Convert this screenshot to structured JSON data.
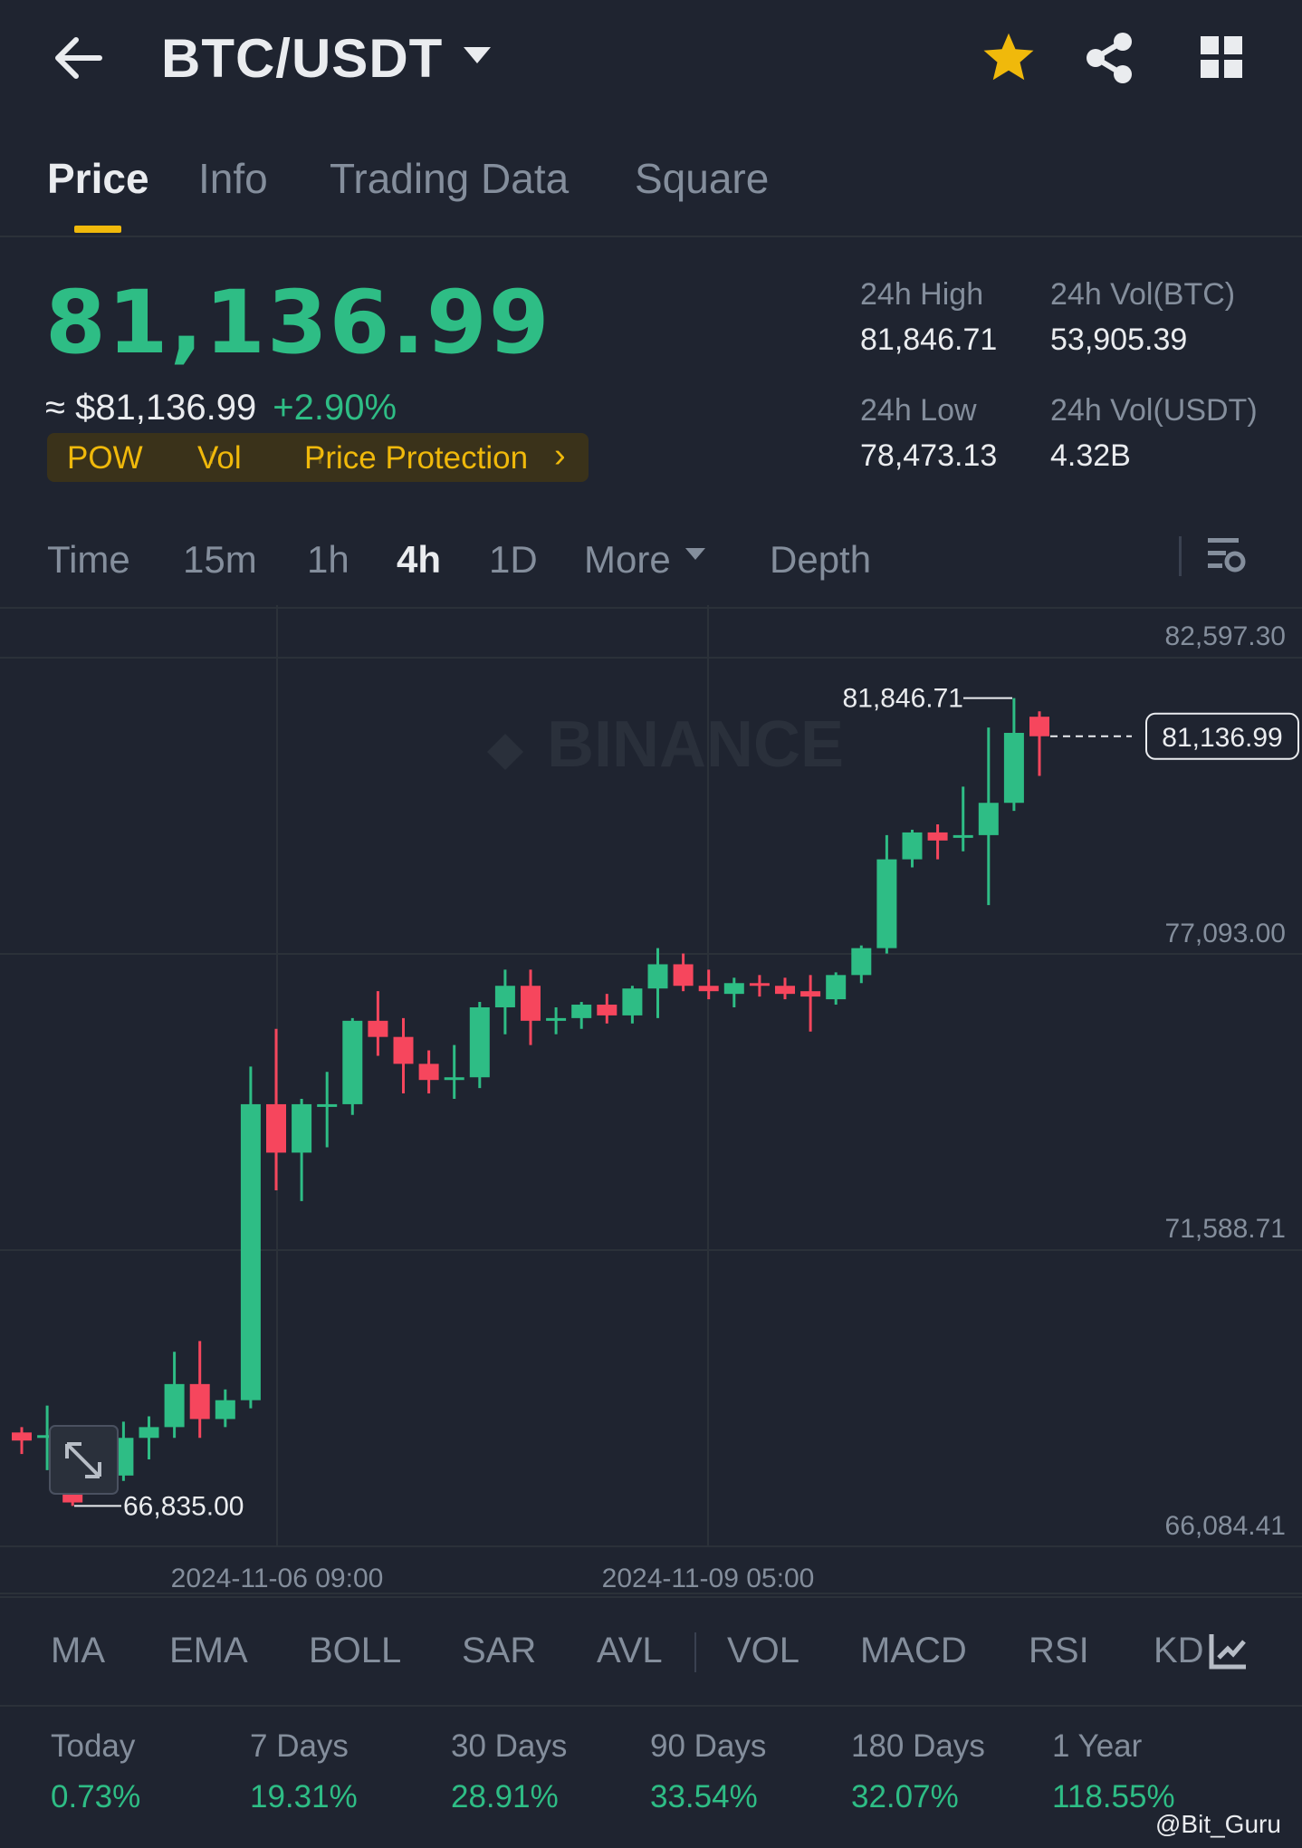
{
  "header": {
    "pair": "BTC/USDT",
    "icons": [
      "back-arrow-icon",
      "dropdown-caret-icon",
      "star-icon",
      "share-icon",
      "grid-menu-icon"
    ],
    "star_color": "#f0b90b"
  },
  "tabs": [
    "Price",
    "Info",
    "Trading Data",
    "Square"
  ],
  "active_tab": "Price",
  "price": {
    "last": "81,136.99",
    "fiat": "≈ $81,136.99",
    "change": "+2.90%",
    "color_up": "#2ebd85",
    "color_down": "#f6465d"
  },
  "tags": {
    "pow": "POW",
    "vol": "Vol",
    "protection": "Price Protection",
    "arrow": "›"
  },
  "stats": {
    "high_label": "24h High",
    "high_value": "81,846.71",
    "low_label": "24h Low",
    "low_value": "78,473.13",
    "vol_btc_label": "24h Vol(BTC)",
    "vol_btc_value": "53,905.39",
    "vol_usdt_label": "24h Vol(USDT)",
    "vol_usdt_value": "4.32B"
  },
  "intervals": {
    "time": "Time",
    "m15": "15m",
    "h1": "1h",
    "h4": "4h",
    "d1": "1D",
    "more": "More",
    "depth": "Depth",
    "active": "4h"
  },
  "chart_data": {
    "type": "candlestick",
    "interval": "4h",
    "y_ticks": [
      "82,597.30",
      "77,093.00",
      "71,588.71",
      "66,084.41"
    ],
    "ylim": [
      66084.41,
      82597.3
    ],
    "x_ticks": [
      "2024-11-06 09:00",
      "2024-11-09 05:00"
    ],
    "high_marker": "81,846.71",
    "low_marker": "66,835.00",
    "last_price": "81,136.99",
    "watermark": "BINANCE",
    "candles": [
      {
        "o": 68200,
        "h": 68300,
        "l": 67800,
        "c": 68050
      },
      {
        "o": 68150,
        "h": 68700,
        "l": 67500,
        "c": 68150
      },
      {
        "o": 68050,
        "h": 68300,
        "l": 66835,
        "c": 66900
      },
      {
        "o": 67300,
        "h": 68000,
        "l": 67200,
        "c": 67400
      },
      {
        "o": 67400,
        "h": 68400,
        "l": 67300,
        "c": 68100
      },
      {
        "o": 68100,
        "h": 68500,
        "l": 67700,
        "c": 68300
      },
      {
        "o": 68300,
        "h": 69700,
        "l": 68100,
        "c": 69100
      },
      {
        "o": 69100,
        "h": 69900,
        "l": 68100,
        "c": 68450
      },
      {
        "o": 68450,
        "h": 69000,
        "l": 68300,
        "c": 68800
      },
      {
        "o": 68800,
        "h": 75000,
        "l": 68650,
        "c": 74300
      },
      {
        "o": 74300,
        "h": 75700,
        "l": 72700,
        "c": 73400
      },
      {
        "o": 73400,
        "h": 74400,
        "l": 72500,
        "c": 74300
      },
      {
        "o": 74300,
        "h": 74900,
        "l": 73500,
        "c": 74300
      },
      {
        "o": 74300,
        "h": 75900,
        "l": 74100,
        "c": 75850
      },
      {
        "o": 75850,
        "h": 76400,
        "l": 75200,
        "c": 75550
      },
      {
        "o": 75550,
        "h": 75900,
        "l": 74500,
        "c": 75050
      },
      {
        "o": 75050,
        "h": 75300,
        "l": 74500,
        "c": 74750
      },
      {
        "o": 74800,
        "h": 75400,
        "l": 74400,
        "c": 74800
      },
      {
        "o": 74800,
        "h": 76200,
        "l": 74600,
        "c": 76100
      },
      {
        "o": 76100,
        "h": 76800,
        "l": 75600,
        "c": 76500
      },
      {
        "o": 76500,
        "h": 76800,
        "l": 75400,
        "c": 75850
      },
      {
        "o": 75850,
        "h": 76100,
        "l": 75600,
        "c": 75900
      },
      {
        "o": 75900,
        "h": 76200,
        "l": 75700,
        "c": 76150
      },
      {
        "o": 76150,
        "h": 76350,
        "l": 75800,
        "c": 75950
      },
      {
        "o": 75950,
        "h": 76500,
        "l": 75800,
        "c": 76450
      },
      {
        "o": 76450,
        "h": 77200,
        "l": 75900,
        "c": 76900
      },
      {
        "o": 76900,
        "h": 77100,
        "l": 76400,
        "c": 76500
      },
      {
        "o": 76500,
        "h": 76800,
        "l": 76250,
        "c": 76400
      },
      {
        "o": 76350,
        "h": 76650,
        "l": 76100,
        "c": 76550
      },
      {
        "o": 76550,
        "h": 76700,
        "l": 76300,
        "c": 76500
      },
      {
        "o": 76500,
        "h": 76650,
        "l": 76250,
        "c": 76350
      },
      {
        "o": 76400,
        "h": 76700,
        "l": 75650,
        "c": 76300
      },
      {
        "o": 76250,
        "h": 76750,
        "l": 76150,
        "c": 76700
      },
      {
        "o": 76700,
        "h": 77250,
        "l": 76550,
        "c": 77200
      },
      {
        "o": 77200,
        "h": 79300,
        "l": 77100,
        "c": 78850
      },
      {
        "o": 78850,
        "h": 79400,
        "l": 78700,
        "c": 79350
      },
      {
        "o": 79350,
        "h": 79500,
        "l": 78850,
        "c": 79200
      },
      {
        "o": 79300,
        "h": 80200,
        "l": 79000,
        "c": 79300
      },
      {
        "o": 79300,
        "h": 81300,
        "l": 78000,
        "c": 79900
      },
      {
        "o": 79900,
        "h": 81846.71,
        "l": 79750,
        "c": 81200
      },
      {
        "o": 81500,
        "h": 81600,
        "l": 80400,
        "c": 81136.99
      }
    ]
  },
  "indicators": [
    "MA",
    "EMA",
    "BOLL",
    "SAR",
    "AVL",
    "VOL",
    "MACD",
    "RSI",
    "KD"
  ],
  "performance": [
    {
      "label": "Today",
      "value": "0.73%"
    },
    {
      "label": "7 Days",
      "value": "19.31%"
    },
    {
      "label": "30 Days",
      "value": "28.91%"
    },
    {
      "label": "90 Days",
      "value": "33.54%"
    },
    {
      "label": "180 Days",
      "value": "32.07%"
    },
    {
      "label": "1 Year",
      "value": "118.55%"
    }
  ],
  "watermark_user": "@Bit_Guru"
}
